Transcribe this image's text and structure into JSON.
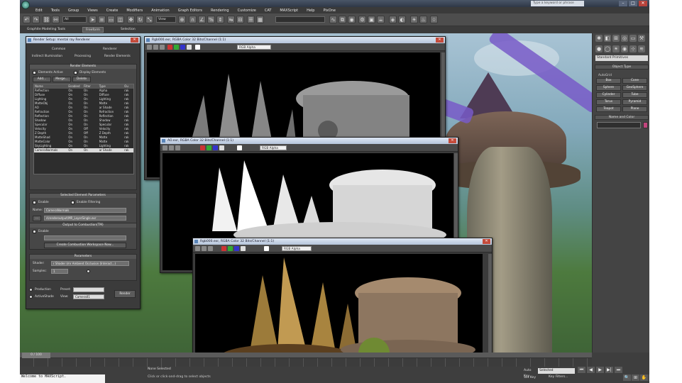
{
  "window": {
    "search_placeholder": "Type a keyword or phrase",
    "controls": [
      "–",
      "□",
      "✕"
    ]
  },
  "menubar": [
    "Edit",
    "Tools",
    "Group",
    "Views",
    "Create",
    "Modifiers",
    "Animation",
    "Graph Editors",
    "Rendering",
    "Customize",
    "CAT",
    "MAXScript",
    "Help",
    "PixOne"
  ],
  "toolbar": {
    "selection_filter": "All",
    "view_combo": "View",
    "named_selection": "",
    "icons": [
      "undo-icon",
      "redo-icon",
      "link-icon",
      "unlink-icon",
      "bind-icon",
      "select-icon",
      "select-by-name-icon",
      "rect-select-icon",
      "window-crossing-icon",
      "move-icon",
      "rotate-icon",
      "scale-icon",
      "pivot-icon",
      "snap-icon",
      "angle-snap-icon",
      "percent-snap-icon",
      "spinner-snap-icon",
      "mirror-icon",
      "align-icon",
      "layer-icon",
      "curve-editor-icon",
      "schematic-icon",
      "material-editor-icon",
      "render-setup-icon",
      "rendered-frame-icon",
      "render-icon"
    ]
  },
  "ribbon": {
    "tabs": [
      "Graphite Modeling Tools",
      "Freeform",
      "Selection"
    ]
  },
  "command_panel": {
    "category": "Standard Primitives",
    "object_type_header": "Object Type",
    "autogrid": "AutoGrid",
    "buttons": [
      "Box",
      "Cone",
      "Sphere",
      "GeoSphere",
      "Cylinder",
      "Tube",
      "Torus",
      "Pyramid",
      "Teapot",
      "Plane"
    ],
    "name_color_header": "Name and Color",
    "swatch_color": "#c1447c"
  },
  "render_setup": {
    "title": "Render Setup: mental ray Renderer",
    "tabs_row1": [
      "Common",
      "Renderer"
    ],
    "tabs_row2": [
      "Indirect Illumination",
      "Processing",
      "Render Elements"
    ],
    "render_elements_header": "Render Elements",
    "elements_active": "Elements Active",
    "display_elements": "Display Elements",
    "buttons": [
      "Add...",
      "Merge...",
      "Delete"
    ],
    "columns": [
      "Name",
      "Enabled",
      "Filter",
      "Type",
      "Ou"
    ],
    "rows": [
      [
        "Reflection",
        "On",
        "On",
        "Alpha",
        "rak"
      ],
      [
        "Diffuse",
        "On",
        "On",
        "Diffuse",
        "rak"
      ],
      [
        "Lighting",
        "On",
        "On",
        "Lighting",
        "rak"
      ],
      [
        "MatteObj",
        "On",
        "On",
        "Matte",
        "rak"
      ],
      [
        "AO",
        "On",
        "On",
        "ar Shade",
        "rak"
      ],
      [
        "Refraction",
        "On",
        "On",
        "Refraction",
        "rak"
      ],
      [
        "Reflection",
        "On",
        "On",
        "Reflection",
        "rak"
      ],
      [
        "Shadow",
        "On",
        "On",
        "Shadow",
        "rak"
      ],
      [
        "Specular",
        "On",
        "On",
        "Specular",
        "rak"
      ],
      [
        "Velocity",
        "On",
        "Off",
        "Velocity",
        "rak"
      ],
      [
        "Z Depth",
        "On",
        "Off",
        "Z Depth",
        "rak"
      ],
      [
        "MatteShad",
        "On",
        "On",
        "Matte",
        "rak"
      ],
      [
        "MatteColor",
        "On",
        "On",
        "Matte",
        "rak"
      ],
      [
        "SkyLighting",
        "On",
        "On",
        "Lighting",
        "rak"
      ],
      [
        "CameraNormals",
        "On",
        "On",
        "ar Shade",
        "rak"
      ]
    ],
    "selected_element_header": "Selected Element Parameters",
    "enable": "Enable",
    "enable_filtering": "Enable Filtering",
    "name_label": "Name:",
    "name_value": "CameraNormals",
    "path_value": "s\\renderoutput\\MR_LayerSingle.exr",
    "output_header": "Output to Combustion(TM)",
    "output_enable": "Enable",
    "create_combustion": "Create Combustion Workspace Now...",
    "parameters_header": "Parameters",
    "shader_label": "Shader:",
    "shader_value": "r Shader (mr Ambient Occlusion (Interact...)",
    "samples_label": "Samples:",
    "samples_value": "1",
    "production": "Production",
    "preset_label": "Preset:",
    "activeshade": "ActiveShade",
    "view_label": "View:",
    "view_value": "Camera01",
    "render_button": "Render"
  },
  "frame_buffers": [
    {
      "title": "Rgb000.exr, RGBA Color 32 Bits/Channel (1:1)",
      "channel": "RGB Alpha"
    },
    {
      "title": "AO.exr, RGBA Color 32 Bits/Channel (1:1)",
      "channel": "RGB Alpha"
    },
    {
      "title": "Rgb000.exr, RGBA Color 32 Bits/Channel (1:1)",
      "channel": "RGB Alpha"
    }
  ],
  "status": {
    "frame_counter": "0 / 100",
    "listener": "Welcome to MAXScript.",
    "selected_text": "None Selected",
    "prompt_text": "Click or click-and-drag to select objects",
    "auto_key": "Auto Key",
    "set_key": "Set Key",
    "selected_combo": "Selected",
    "key_filters": "Key Filters...",
    "play_controls": [
      "⏮",
      "◀",
      "▶",
      "▶|",
      "⏭"
    ],
    "nav_controls": [
      "🔍",
      "⊞",
      "✋",
      "↻",
      "⤢"
    ]
  }
}
